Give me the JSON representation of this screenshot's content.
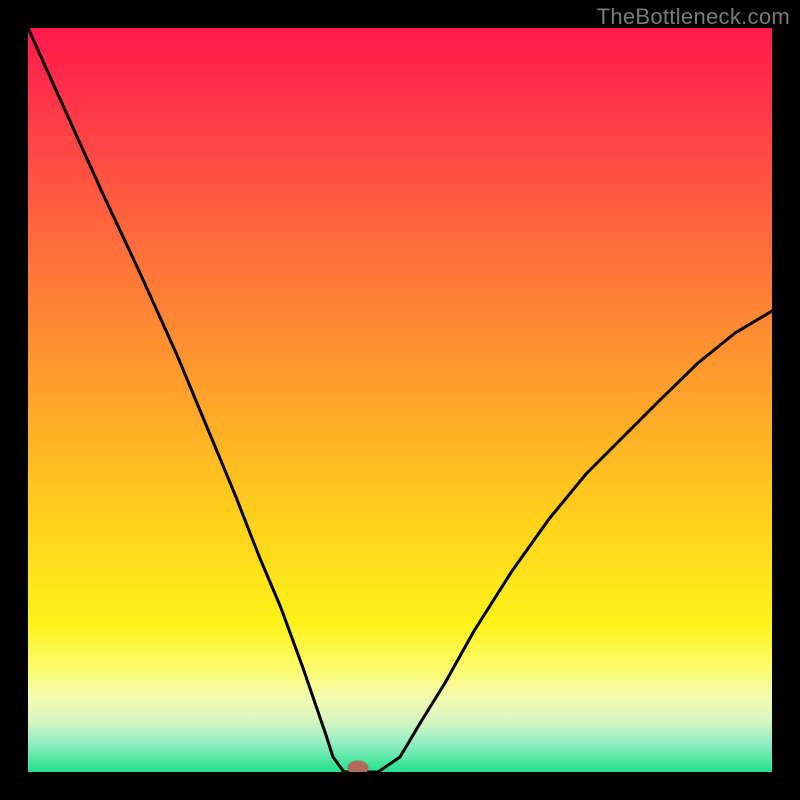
{
  "watermark": "TheBottleneck.com",
  "chart_data": {
    "type": "line",
    "title": "",
    "xlabel": "",
    "ylabel": "",
    "xlim": [
      0,
      100
    ],
    "ylim": [
      0,
      100
    ],
    "series": [
      {
        "name": "curve",
        "x": [
          0,
          5,
          10,
          15,
          20,
          25,
          28,
          31,
          34,
          37,
          40,
          41,
          42.5,
          44,
          47,
          50,
          53,
          56,
          60,
          65,
          70,
          75,
          80,
          85,
          90,
          95,
          100
        ],
        "y": [
          100,
          89,
          78,
          67,
          56,
          44,
          37,
          29,
          22,
          14,
          5,
          2,
          0,
          0,
          0,
          2,
          7,
          12,
          19,
          27,
          34,
          40,
          45,
          50,
          55,
          59,
          62
        ]
      }
    ],
    "marker": {
      "x": 44,
      "y": 0,
      "color": "#b06a5a"
    },
    "background_gradient": {
      "top": "#ff1a4b",
      "mid": "#fff21a",
      "bottom": "#22e08e"
    }
  }
}
